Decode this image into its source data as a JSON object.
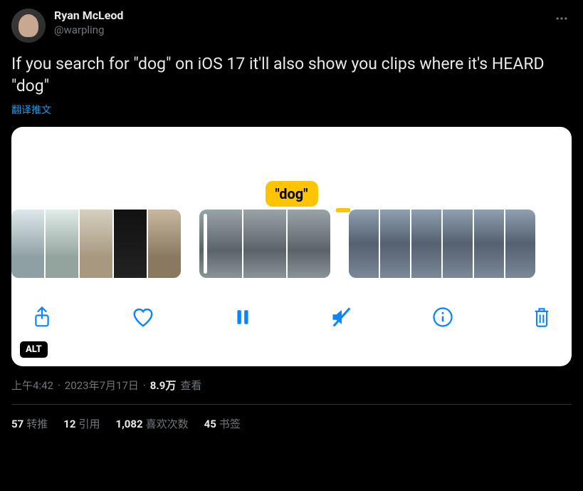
{
  "author": {
    "display_name": "Ryan McLeod",
    "handle": "@warpling"
  },
  "tweet_text": "If you search for \"dog\" on iOS 17 it'll also show you clips where it's HEARD \"dog\"",
  "translate_label": "翻译推文",
  "media": {
    "search_term_label": "\"dog\"",
    "alt_badge": "ALT",
    "toolbar_icons": {
      "share": "share-icon",
      "like": "heart-icon",
      "pause": "pause-icon",
      "mute": "mute-icon",
      "info": "info-icon",
      "trash": "trash-icon"
    }
  },
  "meta": {
    "time": "上午4:42",
    "dot1": "·",
    "date": "2023年7月17日",
    "dot2": "·",
    "views_number": "8.9万",
    "views_label": "查看"
  },
  "stats": {
    "retweets": {
      "count": "57",
      "label": "转推"
    },
    "quotes": {
      "count": "12",
      "label": "引用"
    },
    "likes": {
      "count": "1,082",
      "label": "喜欢次数"
    },
    "bookmarks": {
      "count": "45",
      "label": "书签"
    }
  }
}
